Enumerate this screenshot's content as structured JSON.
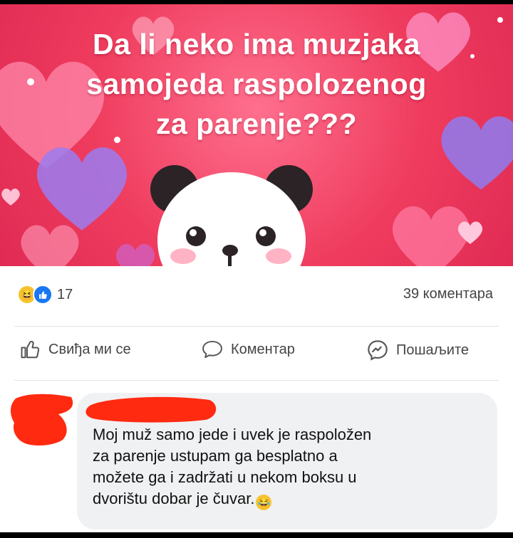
{
  "post": {
    "banner_text_line1": "Da li neko ima muzjaka",
    "banner_text_line2": "samojeda raspolozenog",
    "banner_text_line3": "za parenje???",
    "banner_sticker": "panda-face",
    "colors": {
      "banner_bg": "#e02a54",
      "like_blue": "#1877f2",
      "haha_yellow": "#f7c331",
      "bubble_bg": "#f0f1f3",
      "redaction_red": "#ff2a10"
    }
  },
  "stats": {
    "reaction_icons": [
      "haha-icon",
      "like-icon"
    ],
    "reaction_count": "17",
    "comments_count": "39 коментара"
  },
  "actions": {
    "like_label": "Свиђа ми се",
    "comment_label": "Коментар",
    "share_label": "Пошаљите"
  },
  "comment": {
    "author_redacted": true,
    "line1": "Moj muž samo jede i uvek je raspoložen",
    "line2": "za parenje ustupam ga besplatno a",
    "line3": "možete ga i zadržati u nekom boksu u",
    "line4": "dvorištu dobar je čuvar.",
    "emoji": "laughing-emoji"
  }
}
